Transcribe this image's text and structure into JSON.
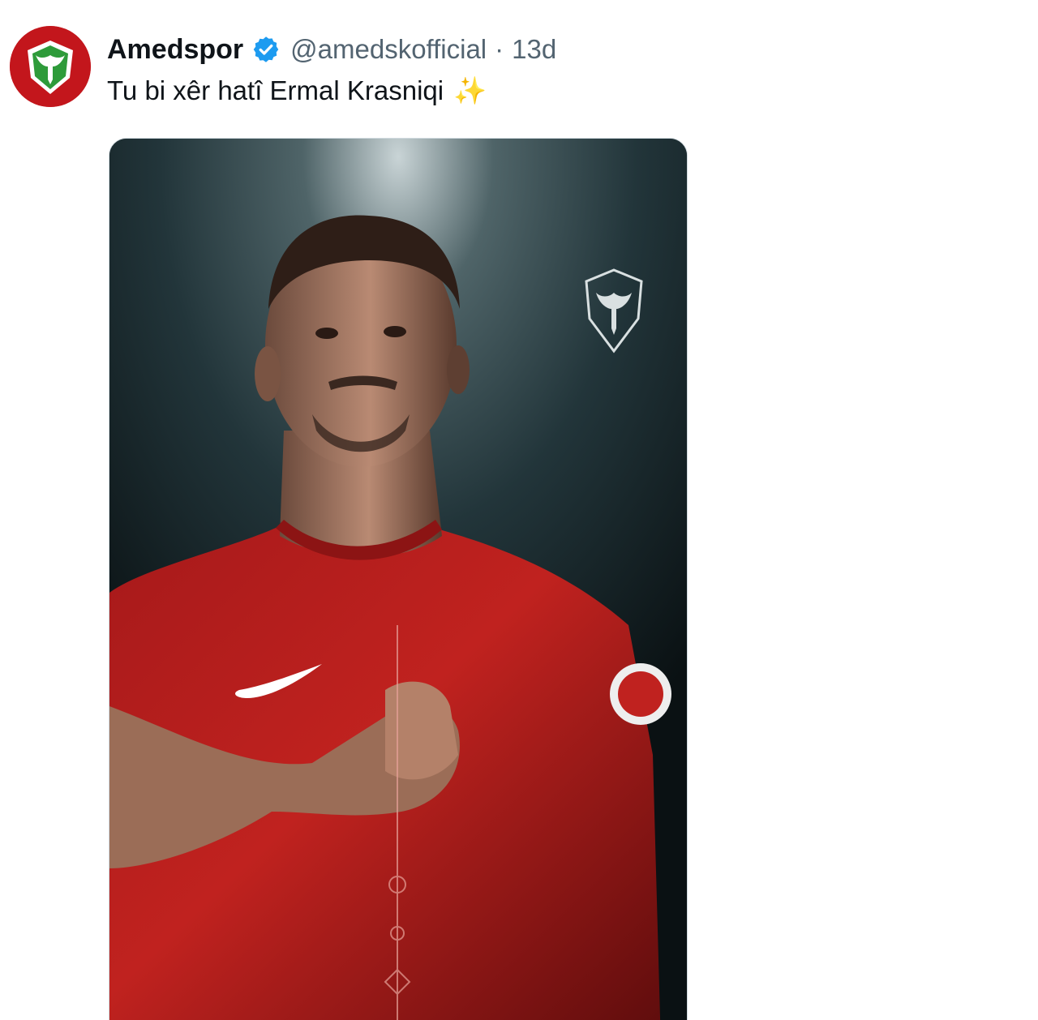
{
  "author": {
    "display_name": "Amedspor",
    "handle": "@amedskofficial",
    "separator": "·",
    "timestamp": "13d",
    "verified": true,
    "avatar_icon": "amedspor-crest-icon",
    "brand_color": "#c3161c",
    "accent_color": "#2e9b3a"
  },
  "tweet": {
    "text": "Tu bi xêr hatî Ermal Krasniqi",
    "emoji": "✨"
  },
  "media": {
    "type": "photo",
    "crest_icon": "amedspor-crest-icon",
    "shirt_color": "#c0221f",
    "background_color": "#1f2f33"
  },
  "colors": {
    "verified_badge": "#1d9bf0",
    "secondary_text": "#536471",
    "primary_text": "#0f1419"
  }
}
